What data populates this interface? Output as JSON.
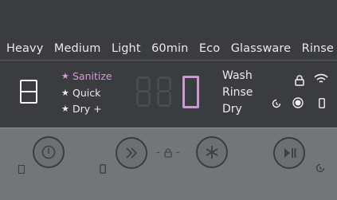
{
  "programs": [
    "Heavy",
    "Medium",
    "Light",
    "60min",
    "Eco",
    "Glassware",
    "Rinse"
  ],
  "options": [
    {
      "label": "Sanitize",
      "active": true
    },
    {
      "label": "Quick",
      "active": false
    },
    {
      "label": "Dry +",
      "active": false
    }
  ],
  "display": {
    "lit_digit": "0"
  },
  "status": [
    "Wash",
    "Rinse",
    "Dry"
  ],
  "childlock": {
    "separator": "-"
  },
  "icons": {
    "door": "door-icon",
    "lock": "lock-icon",
    "wifi": "wifi-icon",
    "delay": "delay-timer-icon",
    "tablet": "tablet-icon",
    "phone": "phone-icon",
    "power": "power-icon",
    "skip": "fast-forward-icon",
    "star": "asterisk-icon",
    "play_pause": "play-pause-icon"
  },
  "colors": {
    "accent": "#d890dc",
    "panel_top": "#3a3c3f",
    "panel_bottom": "#737577"
  }
}
